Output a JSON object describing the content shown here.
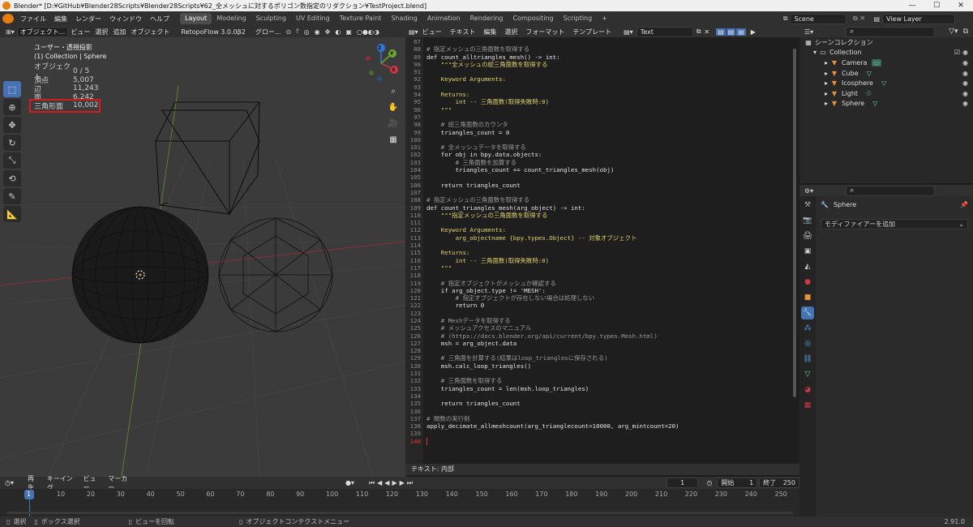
{
  "window": {
    "title": "Blender* [D:¥GitHub¥Blender28Scripts¥Blender28Scripts¥62_全メッシュに対するポリゴン数指定のリダクション¥TestProject.blend]",
    "minimize": "—",
    "maximize": "☐",
    "close": "✕"
  },
  "topbar": {
    "menus": [
      "ファイル",
      "編集",
      "レンダー",
      "ウィンドウ",
      "ヘルプ"
    ],
    "workspaces": [
      "Layout",
      "Modeling",
      "Sculpting",
      "UV Editing",
      "Texture Paint",
      "Shading",
      "Animation",
      "Rendering",
      "Compositing",
      "Scripting"
    ],
    "active_workspace": "Layout",
    "scene": "Scene",
    "view_layer": "View Layer"
  },
  "viewport": {
    "header": {
      "mode": "オブジェクト...",
      "menus": [
        "ビュー",
        "選択",
        "追加",
        "オブジェクト"
      ],
      "addon": "RetopoFlow 3.0.0β2",
      "orientation": "グロー..."
    },
    "view_name": "ユーザー・透視投影",
    "collection_path": "(1) Collection | Sphere",
    "stats": [
      {
        "label": "オブジェクト",
        "value": "0 / 5"
      },
      {
        "label": "頂点",
        "value": "5,007"
      },
      {
        "label": "辺",
        "value": "11,243"
      },
      {
        "label": "面",
        "value": "6,242"
      },
      {
        "label": "三角形面",
        "value": "10,002"
      }
    ],
    "highlight_color": "#d41c1c",
    "gizmo": {
      "x": "X",
      "y": "Y",
      "z": "Z"
    }
  },
  "texteditor": {
    "header": {
      "menus": [
        "ビュー",
        "テキスト",
        "編集",
        "選択",
        "フォーマット",
        "テンプレート"
      ],
      "text_name": "Text"
    },
    "footer": "テキスト: 内部",
    "lines": [
      {
        "n": "87",
        "t": "",
        "c": ""
      },
      {
        "n": "88",
        "t": "# 指定メッシュの三角面数を取得する",
        "c": "cmt"
      },
      {
        "n": "89",
        "t": "def count_alltriangles_mesh() -> int:",
        "c": ""
      },
      {
        "n": "90",
        "t": "    \"\"\"全メッシュの総三角面数を取得する",
        "c": "str"
      },
      {
        "n": "91",
        "t": "",
        "c": "str"
      },
      {
        "n": "92",
        "t": "    Keyword Arguments:",
        "c": "str"
      },
      {
        "n": "93",
        "t": "",
        "c": "str"
      },
      {
        "n": "94",
        "t": "    Returns:",
        "c": "str"
      },
      {
        "n": "95",
        "t": "        int -- 三角面数(取得失敗時:0)",
        "c": "str"
      },
      {
        "n": "96",
        "t": "    \"\"\"",
        "c": "str"
      },
      {
        "n": "97",
        "t": "",
        "c": ""
      },
      {
        "n": "98",
        "t": "    # 総三角面数のカウンタ",
        "c": "cmt"
      },
      {
        "n": "99",
        "t": "    triangles_count = 0",
        "c": ""
      },
      {
        "n": "100",
        "t": "",
        "c": ""
      },
      {
        "n": "101",
        "t": "    # 全メッシュデータを取得する",
        "c": "cmt"
      },
      {
        "n": "102",
        "t": "    for obj in bpy.data.objects:",
        "c": ""
      },
      {
        "n": "103",
        "t": "        # 三角面数を加算する",
        "c": "cmt"
      },
      {
        "n": "104",
        "t": "        triangles_count += count_triangles_mesh(obj)",
        "c": ""
      },
      {
        "n": "105",
        "t": "",
        "c": ""
      },
      {
        "n": "106",
        "t": "    return triangles_count",
        "c": ""
      },
      {
        "n": "107",
        "t": "",
        "c": ""
      },
      {
        "n": "108",
        "t": "# 指定メッシュの三角面数を取得する",
        "c": "cmt"
      },
      {
        "n": "109",
        "t": "def count_triangles_mesh(arg_object) -> int:",
        "c": ""
      },
      {
        "n": "110",
        "t": "    \"\"\"指定メッシュの三角面数を取得する",
        "c": "str"
      },
      {
        "n": "111",
        "t": "",
        "c": "str"
      },
      {
        "n": "112",
        "t": "    Keyword Arguments:",
        "c": "str"
      },
      {
        "n": "113",
        "t": "        arg_objectname {bpy.types.Object} -- 対象オブジェクト",
        "c": "str"
      },
      {
        "n": "114",
        "t": "",
        "c": "str"
      },
      {
        "n": "115",
        "t": "    Returns:",
        "c": "str"
      },
      {
        "n": "116",
        "t": "        int -- 三角面数(取得失敗時:0)",
        "c": "str"
      },
      {
        "n": "117",
        "t": "    \"\"\"",
        "c": "str"
      },
      {
        "n": "118",
        "t": "",
        "c": ""
      },
      {
        "n": "119",
        "t": "    # 指定オブジェクトがメッシュか確認する",
        "c": "cmt"
      },
      {
        "n": "120",
        "t": "    if arg_object.type != 'MESH':",
        "c": ""
      },
      {
        "n": "121",
        "t": "        # 指定オブジェクトが存在しない場合は処理しない",
        "c": "cmt"
      },
      {
        "n": "122",
        "t": "        return 0",
        "c": ""
      },
      {
        "n": "123",
        "t": "",
        "c": ""
      },
      {
        "n": "124",
        "t": "    # Meshデータを取得する",
        "c": "cmt"
      },
      {
        "n": "125",
        "t": "    # メッシュアクセスのマニュアル",
        "c": "cmt"
      },
      {
        "n": "126",
        "t": "    # (https://docs.blender.org/api/current/bpy.types.Mesh.html)",
        "c": "cmt"
      },
      {
        "n": "127",
        "t": "    msh = arg_object.data",
        "c": ""
      },
      {
        "n": "128",
        "t": "",
        "c": ""
      },
      {
        "n": "129",
        "t": "    # 三角面を計算する(結果はloop_trianglesに保存される)",
        "c": "cmt"
      },
      {
        "n": "130",
        "t": "    msh.calc_loop_triangles()",
        "c": ""
      },
      {
        "n": "131",
        "t": "",
        "c": ""
      },
      {
        "n": "132",
        "t": "    # 三角面数を取得する",
        "c": "cmt"
      },
      {
        "n": "133",
        "t": "    triangles_count = len(msh.loop_triangles)",
        "c": ""
      },
      {
        "n": "134",
        "t": "",
        "c": ""
      },
      {
        "n": "135",
        "t": "    return triangles_count",
        "c": ""
      },
      {
        "n": "136",
        "t": "",
        "c": ""
      },
      {
        "n": "137",
        "t": "# 関数の実行例",
        "c": "cmt"
      },
      {
        "n": "138",
        "t": "apply_decimate_allmeshcount(arg_trianglecount=10000, arg_mintcount=20)",
        "c": ""
      },
      {
        "n": "139",
        "t": "",
        "c": ""
      },
      {
        "n": "140",
        "t": "",
        "c": "cur"
      }
    ]
  },
  "outliner": {
    "root": "シーンコレクション",
    "collection": "Collection",
    "objects": [
      {
        "name": "Camera",
        "icon": "camera-icon",
        "color": "#e8913a"
      },
      {
        "name": "Cube",
        "icon": "mesh-icon",
        "color": "#e8913a"
      },
      {
        "name": "Icosphere",
        "icon": "mesh-icon",
        "color": "#e8913a"
      },
      {
        "name": "Light",
        "icon": "light-icon",
        "color": "#e8913a"
      },
      {
        "name": "Sphere",
        "icon": "mesh-icon",
        "color": "#e8913a"
      }
    ]
  },
  "properties": {
    "object_name": "Sphere",
    "add_modifier": "モディファイアーを追加"
  },
  "timeline": {
    "menus": [
      "再生",
      "キーイング",
      "ビュー",
      "マーカー"
    ],
    "current_frame": "1",
    "start_label": "開始",
    "start": "1",
    "end_label": "終了",
    "end": "250",
    "ticks": [
      "1",
      "10",
      "20",
      "30",
      "40",
      "50",
      "60",
      "70",
      "80",
      "90",
      "100",
      "110",
      "120",
      "130",
      "140",
      "150",
      "160",
      "170",
      "180",
      "190",
      "200",
      "210",
      "220",
      "230",
      "240",
      "250"
    ]
  },
  "statusbar": {
    "items": [
      "選択",
      "ボックス選択",
      "ビューを回転",
      "オブジェクトコンテクストメニュー"
    ],
    "version": "2.91.0"
  },
  "colors": {
    "accent": "#4772b3",
    "orange": "#e8913a",
    "highlight": "#d41c1c"
  }
}
